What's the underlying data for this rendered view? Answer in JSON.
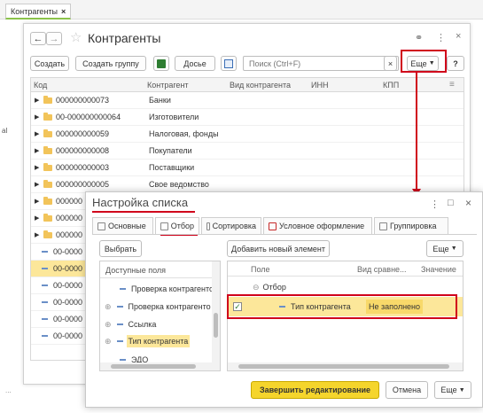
{
  "window_tab": {
    "label": "Контрагенты",
    "close": "×"
  },
  "header": {
    "title": "Контрагенты",
    "link_icon": "link-icon",
    "more_icon": "⋮",
    "close": "×"
  },
  "toolbar": {
    "create": "Создать",
    "create_group": "Создать группу",
    "dossier": "Досье",
    "search_placeholder": "Поиск (Ctrl+F)",
    "search_clear": "×",
    "more": "Еще",
    "help": "?"
  },
  "grid": {
    "columns": [
      "Код",
      "Контрагент",
      "Вид контрагента",
      "ИНН",
      "КПП"
    ],
    "rows": [
      {
        "code": "000000000073",
        "name": "Банки"
      },
      {
        "code": "00-000000000064",
        "name": "Изготовители"
      },
      {
        "code": "000000000059",
        "name": "Налоговая, фонды"
      },
      {
        "code": "000000000008",
        "name": "Покупатели"
      },
      {
        "code": "000000000003",
        "name": "Поставщики"
      },
      {
        "code": "000000000005",
        "name": "Свое ведомство"
      }
    ],
    "hidden_rows": [
      {
        "kind": "folder",
        "code": "000000"
      },
      {
        "kind": "folder",
        "code": "000000"
      },
      {
        "kind": "folder",
        "code": "000000"
      },
      {
        "kind": "item",
        "code": "00-0000"
      },
      {
        "kind": "item",
        "code": "00-0000"
      },
      {
        "kind": "item",
        "code": "00-0000"
      },
      {
        "kind": "item",
        "code": "00-0000"
      },
      {
        "kind": "item",
        "code": "00-0000"
      },
      {
        "kind": "item",
        "code": "00-0000"
      }
    ]
  },
  "left_marker": "al",
  "bottom_left_text": "...",
  "dialog": {
    "title": "Настройка списка",
    "more_icon": "⋮",
    "maximize": "□",
    "close": "×",
    "tabs": [
      "Основные",
      "Отбор",
      "Сортировка",
      "Условное оформление",
      "Группировка"
    ],
    "active_tab": "Отбор",
    "select_button": "Выбрать",
    "available_fields_header": "Доступные поля",
    "available_fields": [
      "Проверка контрагенто",
      "Проверка контрагенто",
      "Ссылка",
      "Тип контрагента",
      "ЭДО"
    ],
    "selected_field": "Тип контрагента",
    "add_element_button": "Добавить новый элемент",
    "more": "Еще",
    "filter_columns": [
      "Поле",
      "Вид сравне...",
      "Значение"
    ],
    "filter_group": "Отбор",
    "filter_item": {
      "field": "Тип контрагента",
      "comparison": "Не заполнено",
      "checked": true
    },
    "finish_button": "Завершить редактирование",
    "cancel_button": "Отмена"
  },
  "colors": {
    "accent_red": "#d0021b",
    "finish_yellow": "#f5d52c",
    "highlight_yellow": "#fce79a",
    "folder": "#f2c45a"
  }
}
